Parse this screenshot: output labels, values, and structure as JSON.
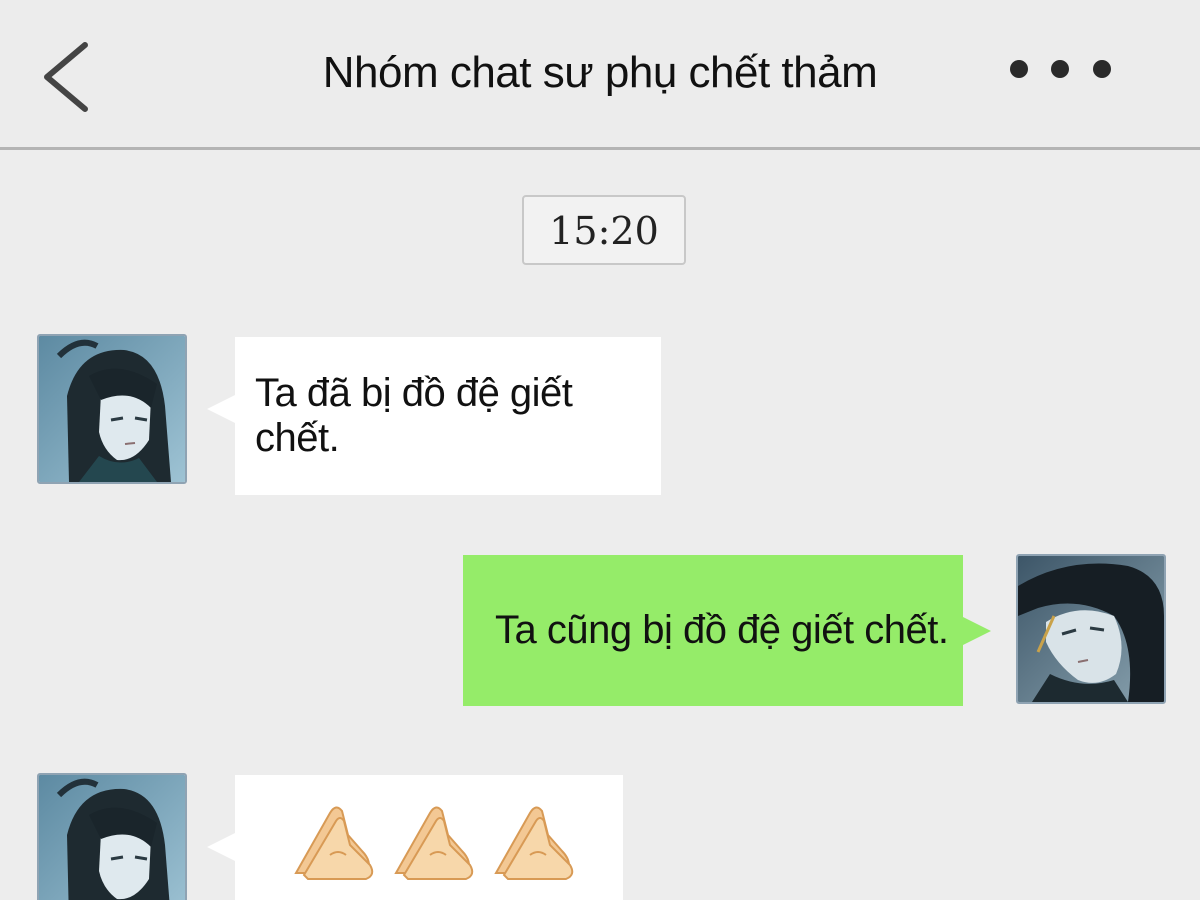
{
  "header": {
    "title": "Nhóm chat sư phụ chết thảm",
    "back_icon": "chevron-left-icon",
    "more_icon": "more-dots-icon"
  },
  "timestamp": "15:20",
  "messages": [
    {
      "side": "left",
      "type": "text",
      "text": "Ta đã bị đồ đệ giết chết.",
      "avatar": "long-haired-man-avatar"
    },
    {
      "side": "right",
      "type": "text",
      "text": "Ta cũng bị đồ đệ giết chết.",
      "avatar": "long-haired-man-avatar"
    },
    {
      "side": "left",
      "type": "emoji",
      "emoji": [
        "folded-hands-icon",
        "folded-hands-icon",
        "folded-hands-icon"
      ],
      "avatar": "long-haired-man-avatar"
    }
  ],
  "colors": {
    "background": "#ededed",
    "received_bubble": "#ffffff",
    "sent_bubble": "#95ec69",
    "header_divider": "#b4b4b4"
  }
}
